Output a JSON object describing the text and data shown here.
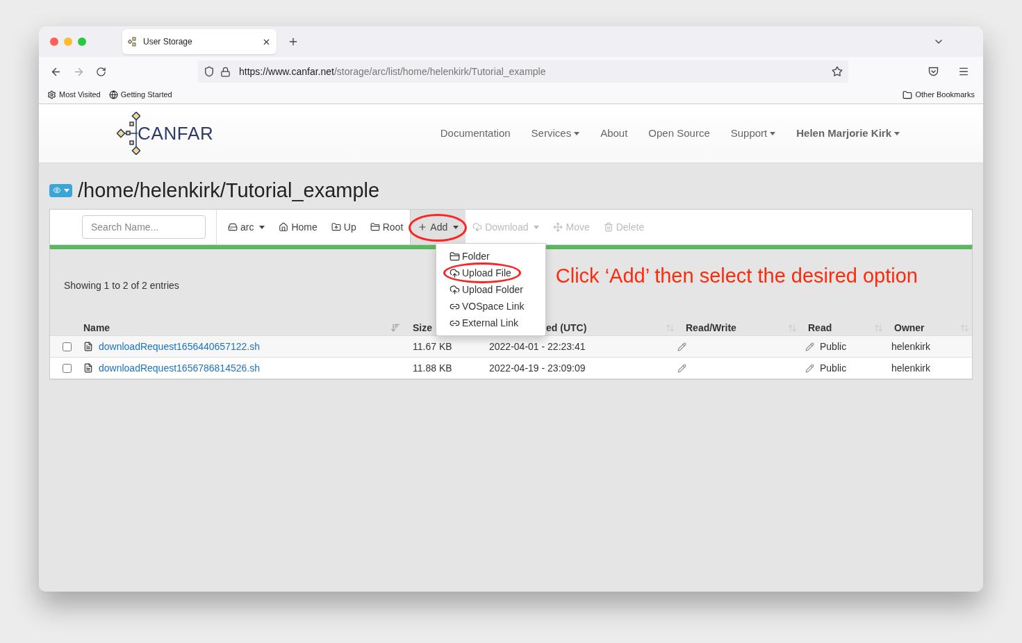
{
  "browser": {
    "tab_title": "User Storage",
    "url_host": "https://www.canfar.net",
    "url_path": "/storage/arc/list/home/helenkirk/Tutorial_example",
    "bookmarks": [
      {
        "kind": "gear",
        "label": "Most Visited"
      },
      {
        "kind": "globe",
        "label": "Getting Started"
      }
    ],
    "other_bookmarks": "Other Bookmarks"
  },
  "site": {
    "logo": "CANFAR",
    "nav": [
      {
        "label": "Documentation",
        "dropdown": false,
        "bold": false
      },
      {
        "label": "Services",
        "dropdown": true,
        "bold": false
      },
      {
        "label": "About",
        "dropdown": false,
        "bold": false
      },
      {
        "label": "Open Source",
        "dropdown": false,
        "bold": false
      },
      {
        "label": "Support",
        "dropdown": true,
        "bold": false
      },
      {
        "label": "Helen Marjorie Kirk",
        "dropdown": true,
        "bold": true
      }
    ]
  },
  "page_title": "/home/helenkirk/Tutorial_example",
  "toolbar": {
    "search_placeholder": "Search Name...",
    "buttons": [
      {
        "kind": "drive",
        "label": "arc",
        "dropdown": true,
        "disabled": false,
        "active": false,
        "highlighted": false
      },
      {
        "kind": "home",
        "label": "Home",
        "dropdown": false,
        "disabled": false,
        "active": false,
        "highlighted": false
      },
      {
        "kind": "up",
        "label": "Up",
        "dropdown": false,
        "disabled": false,
        "active": false,
        "highlighted": false
      },
      {
        "kind": "folder",
        "label": "Root",
        "dropdown": false,
        "disabled": false,
        "active": false,
        "highlighted": false
      },
      {
        "kind": "plus",
        "label": "Add",
        "dropdown": true,
        "disabled": false,
        "active": true,
        "highlighted": true
      },
      {
        "kind": "download",
        "label": "Download",
        "dropdown": true,
        "disabled": true,
        "active": false,
        "highlighted": false
      },
      {
        "kind": "move",
        "label": "Move",
        "dropdown": false,
        "disabled": true,
        "active": false,
        "highlighted": false
      },
      {
        "kind": "trash",
        "label": "Delete",
        "dropdown": false,
        "disabled": true,
        "active": false,
        "highlighted": false
      }
    ]
  },
  "add_menu": [
    {
      "kind": "folder",
      "label": "Folder",
      "highlighted": false
    },
    {
      "kind": "upload",
      "label": "Upload File",
      "highlighted": true
    },
    {
      "kind": "upload",
      "label": "Upload Folder",
      "highlighted": false
    },
    {
      "kind": "link",
      "label": "VOSpace Link",
      "highlighted": false
    },
    {
      "kind": "link",
      "label": "External Link",
      "highlighted": false
    }
  ],
  "annotation": "Click ‘Add’ then select the desired option",
  "entries_info": "Showing 1 to 2 of 2 entries",
  "table": {
    "columns": [
      "Name",
      "Size",
      "ed (UTC)",
      "Read/Write",
      "Read",
      "Owner"
    ],
    "rows": [
      {
        "checked": false,
        "name": "downloadRequest1656440657122.sh",
        "size": "11.67 KB",
        "modified": "2022-04-01 - 22:23:41",
        "read": "Public",
        "owner": "helenkirk"
      },
      {
        "checked": false,
        "name": "downloadRequest1656786814526.sh",
        "size": "11.88 KB",
        "modified": "2022-04-19 - 23:09:09",
        "read": "Public",
        "owner": "helenkirk"
      }
    ]
  }
}
